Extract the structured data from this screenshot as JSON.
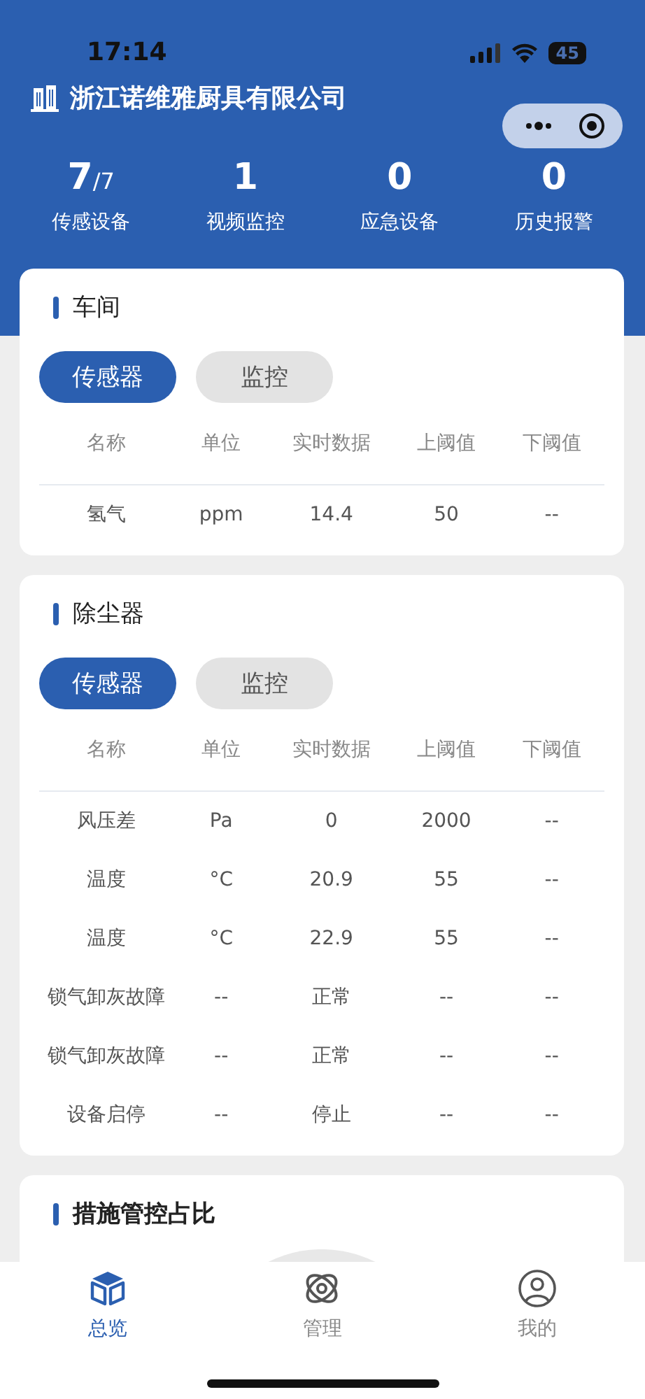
{
  "status_bar": {
    "time": "17:14",
    "battery": "45"
  },
  "header": {
    "company": "浙江诺维雅厨具有限公司"
  },
  "stats": [
    {
      "value": "7",
      "suffix": "/7",
      "label": "传感设备"
    },
    {
      "value": "1",
      "label": "视频监控"
    },
    {
      "value": "0",
      "label": "应急设备"
    },
    {
      "value": "0",
      "label": "历史报警"
    }
  ],
  "cards": [
    {
      "title": "车间",
      "tabs": [
        {
          "label": "传感器",
          "selected": true
        },
        {
          "label": "监控",
          "selected": false
        }
      ],
      "table": {
        "columns": [
          "名称",
          "单位",
          "实时数据",
          "上阈值",
          "下阈值"
        ],
        "rows": [
          [
            "氢气",
            "ppm",
            "14.4",
            "50",
            "--"
          ]
        ]
      }
    },
    {
      "title": "除尘器",
      "tabs": [
        {
          "label": "传感器",
          "selected": true
        },
        {
          "label": "监控",
          "selected": false
        }
      ],
      "table": {
        "columns": [
          "名称",
          "单位",
          "实时数据",
          "上阈值",
          "下阈值"
        ],
        "rows": [
          [
            "风压差",
            "Pa",
            "0",
            "2000",
            "--"
          ],
          [
            "温度",
            "°C",
            "20.9",
            "55",
            "--"
          ],
          [
            "温度",
            "°C",
            "22.9",
            "55",
            "--"
          ],
          [
            "锁气卸灰故障",
            "--",
            "正常",
            "--",
            "--"
          ],
          [
            "锁气卸灰故障",
            "--",
            "正常",
            "--",
            "--"
          ],
          [
            "设备启停",
            "--",
            "停止",
            "--",
            "--"
          ]
        ]
      }
    }
  ],
  "chart_card": {
    "title": "措施管控占比"
  },
  "tab_bar": [
    {
      "label": "总览",
      "selected": true
    },
    {
      "label": "管理",
      "selected": false
    },
    {
      "label": "我的",
      "selected": false
    }
  ]
}
